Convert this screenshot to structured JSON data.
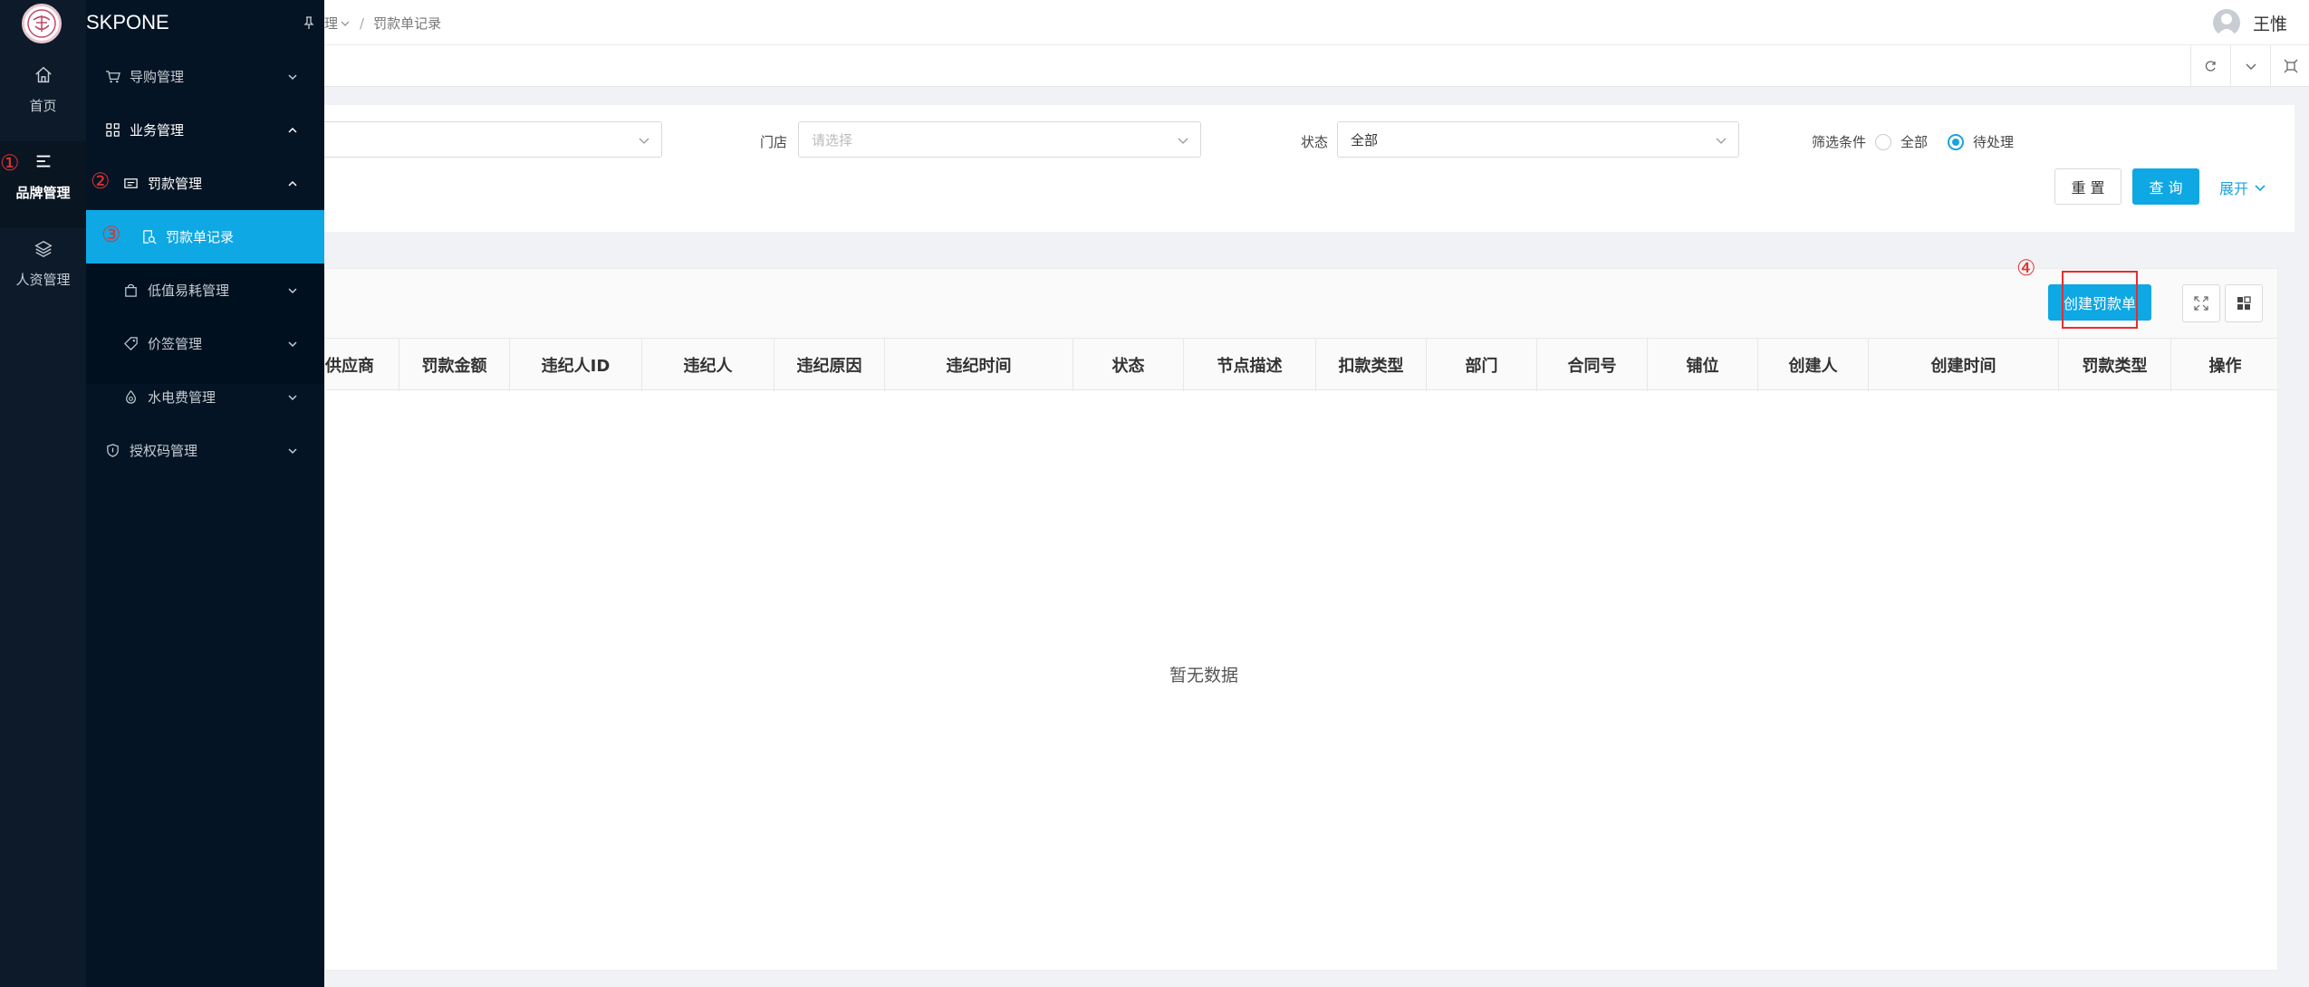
{
  "brand": {
    "name": "SKPONE"
  },
  "rail": [
    {
      "label": "首页",
      "icon": "home-icon"
    },
    {
      "label": "品牌管理",
      "icon": "menu-lines-icon"
    },
    {
      "label": "人资管理",
      "icon": "layers-icon"
    }
  ],
  "menu": {
    "guide": "导购管理",
    "business": "业务管理",
    "fine": "罚款管理",
    "fine_record": "罚款单记录",
    "low_value": "低值易耗管理",
    "price_tag": "价签管理",
    "utility": "水电费管理",
    "auth_code": "授权码管理"
  },
  "breadcrumb": {
    "parent": "理",
    "current": "罚款单记录",
    "separator": "/"
  },
  "user": {
    "name": "王惟"
  },
  "filters": {
    "store_label": "门店",
    "store_placeholder": "请选择",
    "status_label": "状态",
    "status_value": "全部",
    "cond_label": "筛选条件",
    "cond_all": "全部",
    "cond_pending": "待处理",
    "cond_selected": "待处理"
  },
  "buttons": {
    "reset": "重 置",
    "query": "查 询",
    "expand": "展开",
    "create": "创建罚款单"
  },
  "table": {
    "columns": [
      "供应商",
      "罚款金额",
      "违纪人ID",
      "违纪人",
      "违纪原因",
      "违纪时间",
      "状态",
      "节点描述",
      "扣款类型",
      "部门",
      "合同号",
      "铺位",
      "创建人",
      "创建时间",
      "罚款类型",
      "操作"
    ],
    "empty_text": "暂无数据"
  },
  "annotations": [
    "①",
    "②",
    "③",
    "④"
  ]
}
